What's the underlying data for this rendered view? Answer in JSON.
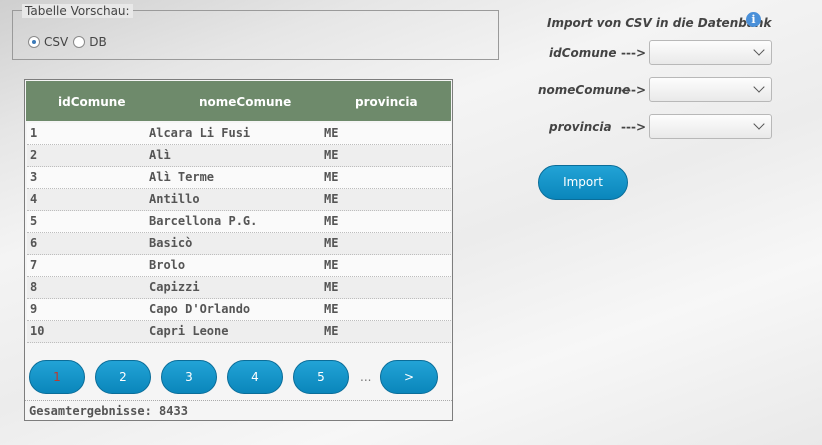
{
  "preview": {
    "legend": "Tabelle Vorschau:",
    "options": [
      {
        "label": "CSV",
        "selected": true
      },
      {
        "label": "DB",
        "selected": false
      }
    ]
  },
  "table": {
    "columns": [
      "idComune",
      "nomeComune",
      "provincia"
    ],
    "rows": [
      [
        "1",
        "Alcara Li Fusi",
        "ME"
      ],
      [
        "2",
        "Alì",
        "ME"
      ],
      [
        "3",
        "Alì Terme",
        "ME"
      ],
      [
        "4",
        "Antillo",
        "ME"
      ],
      [
        "5",
        "Barcellona P.G.",
        "ME"
      ],
      [
        "6",
        "Basicò",
        "ME"
      ],
      [
        "7",
        "Brolo",
        "ME"
      ],
      [
        "8",
        "Capizzi",
        "ME"
      ],
      [
        "9",
        "Capo D'Orlando",
        "ME"
      ],
      [
        "10",
        "Capri Leone",
        "ME"
      ]
    ],
    "pages": [
      "1",
      "2",
      "3",
      "4",
      "5"
    ],
    "current_page": "1",
    "ellipsis": "...",
    "next_label": ">",
    "total": "Gesamtergebnisse: 8433"
  },
  "import": {
    "title": "Import von CSV in die Datenbank",
    "info_icon": "info-icon",
    "fields": [
      {
        "label": "idComune",
        "arrow": "--->",
        "value": ""
      },
      {
        "label": "nomeComune",
        "arrow": "--->",
        "value": ""
      },
      {
        "label": "provincia",
        "arrow": "--->",
        "value": ""
      }
    ],
    "button_label": "Import"
  },
  "colors": {
    "header_bg": "#6e8a6b",
    "button_blue": "#1499cc",
    "current_page_text": "#c0392b"
  }
}
